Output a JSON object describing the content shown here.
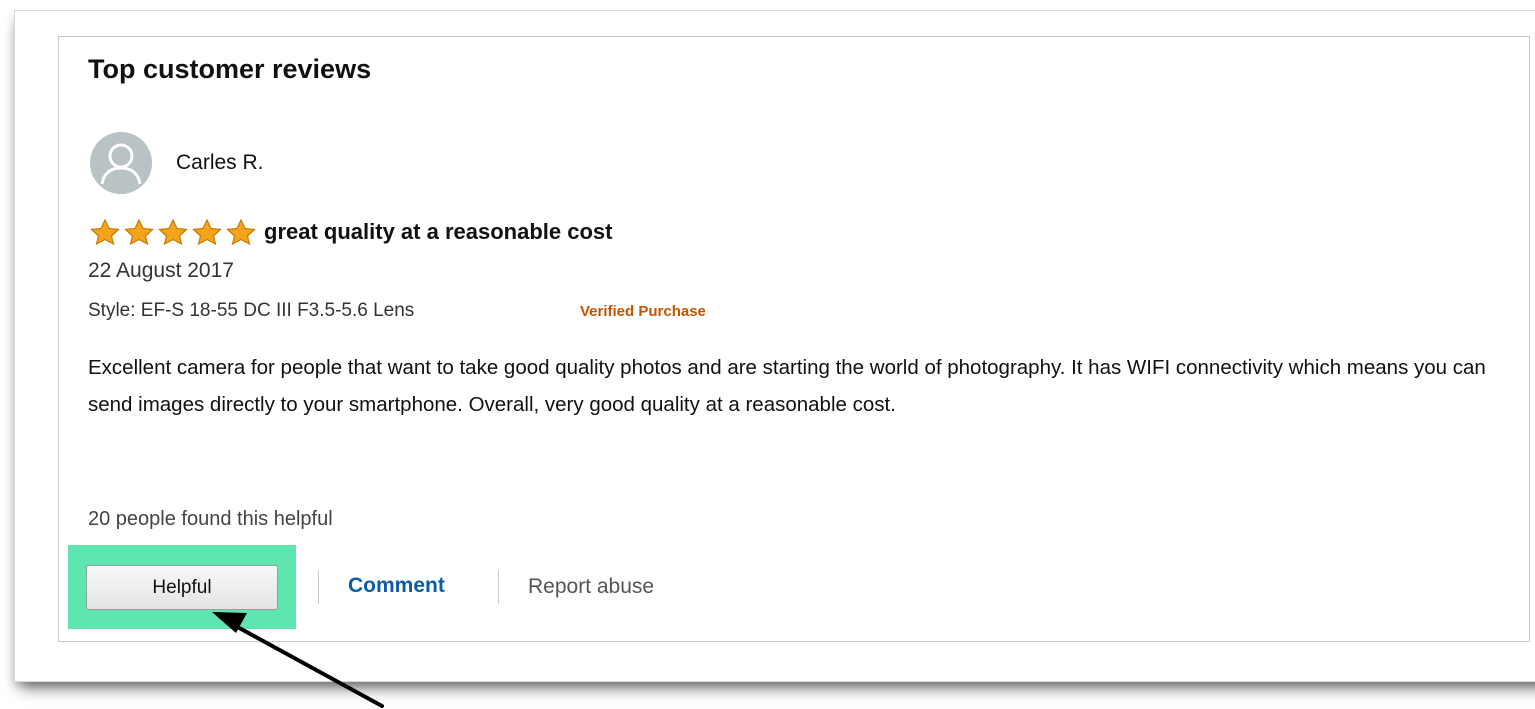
{
  "section": {
    "title": "Top customer reviews"
  },
  "review": {
    "reviewer_name": "Carles R.",
    "avatar_icon": "user-avatar-icon",
    "rating": 5,
    "rating_max": 5,
    "star_color": "#f4a41c",
    "title": "great quality at a reasonable cost",
    "date": "22 August 2017",
    "style": "Style: EF-S 18-55 DC III F3.5-5.6 Lens",
    "verified_label": "Verified Purchase",
    "verified_color": "#c45500",
    "body": "Excellent camera for people that want to take good quality photos and are starting the world of photography. It has WIFI connectivity which means you can send images directly to your smartphone. Overall, very good quality at a reasonable cost.",
    "helpful_count_text": "20 people found this helpful"
  },
  "actions": {
    "helpful_label": "Helpful",
    "comment_label": "Comment",
    "report_label": "Report abuse",
    "comment_color": "#0d5bab"
  },
  "annotation": {
    "highlight_color": "#5fe6b0",
    "arrow_icon": "pointer-arrow-icon"
  }
}
